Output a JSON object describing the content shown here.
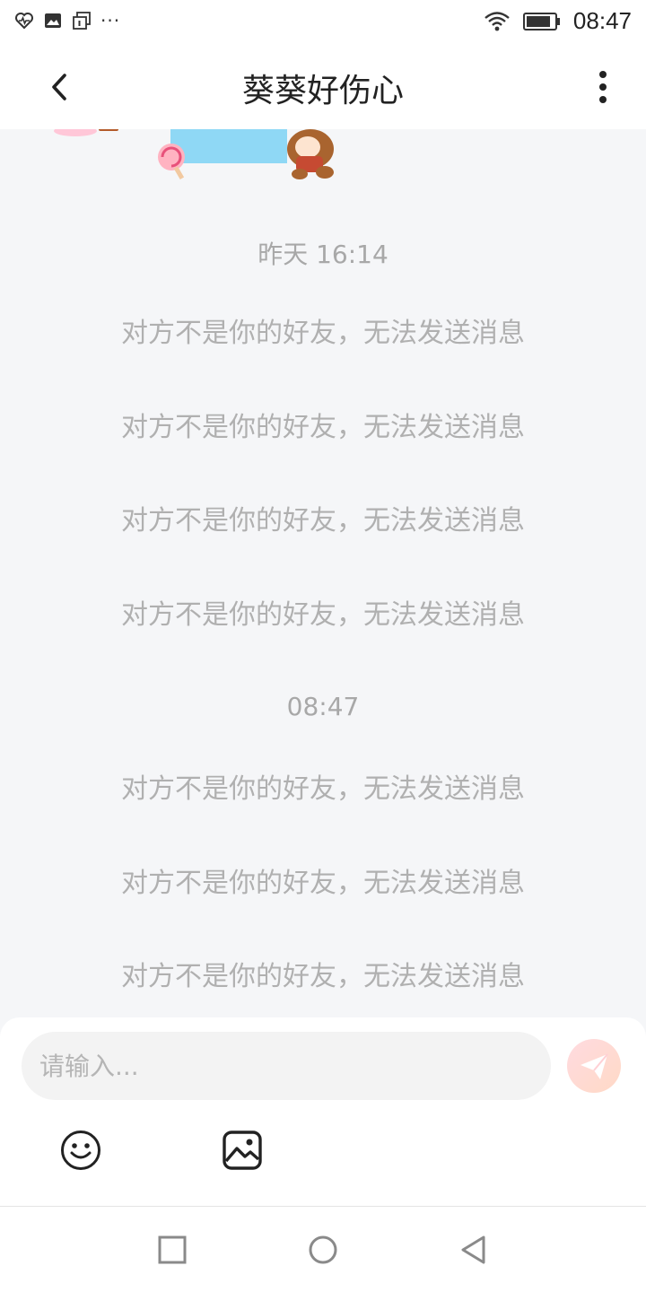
{
  "status_bar": {
    "time": "08:47",
    "icons": [
      "heart-monitor-icon",
      "image-icon",
      "window-icon",
      "more-dots-icon",
      "wifi-icon",
      "battery-icon"
    ],
    "more": "···"
  },
  "header": {
    "title": "葵葵好伤心",
    "back_icon": "back-arrow-icon",
    "more_icon": "vertical-more-icon"
  },
  "chat": {
    "groups": [
      {
        "time": "昨天 16:14",
        "messages": [
          "对方不是你的好友，无法发送消息",
          "对方不是你的好友，无法发送消息",
          "对方不是你的好友，无法发送消息",
          "对方不是你的好友，无法发送消息"
        ]
      },
      {
        "time": "08:47",
        "messages": [
          "对方不是你的好友，无法发送消息",
          "对方不是你的好友，无法发送消息",
          "对方不是你的好友，无法发送消息"
        ]
      }
    ]
  },
  "composer": {
    "placeholder": "请输入...",
    "value": "",
    "send_icon": "paper-plane-icon",
    "tools": [
      "smiley-icon",
      "image-icon"
    ]
  },
  "nav_bar": {
    "buttons": [
      "recent-apps-icon",
      "home-icon",
      "back-icon"
    ]
  },
  "colors": {
    "background": "#f5f6f8",
    "system_text": "#b0b0b0",
    "send_button": "#ffd9dc"
  }
}
